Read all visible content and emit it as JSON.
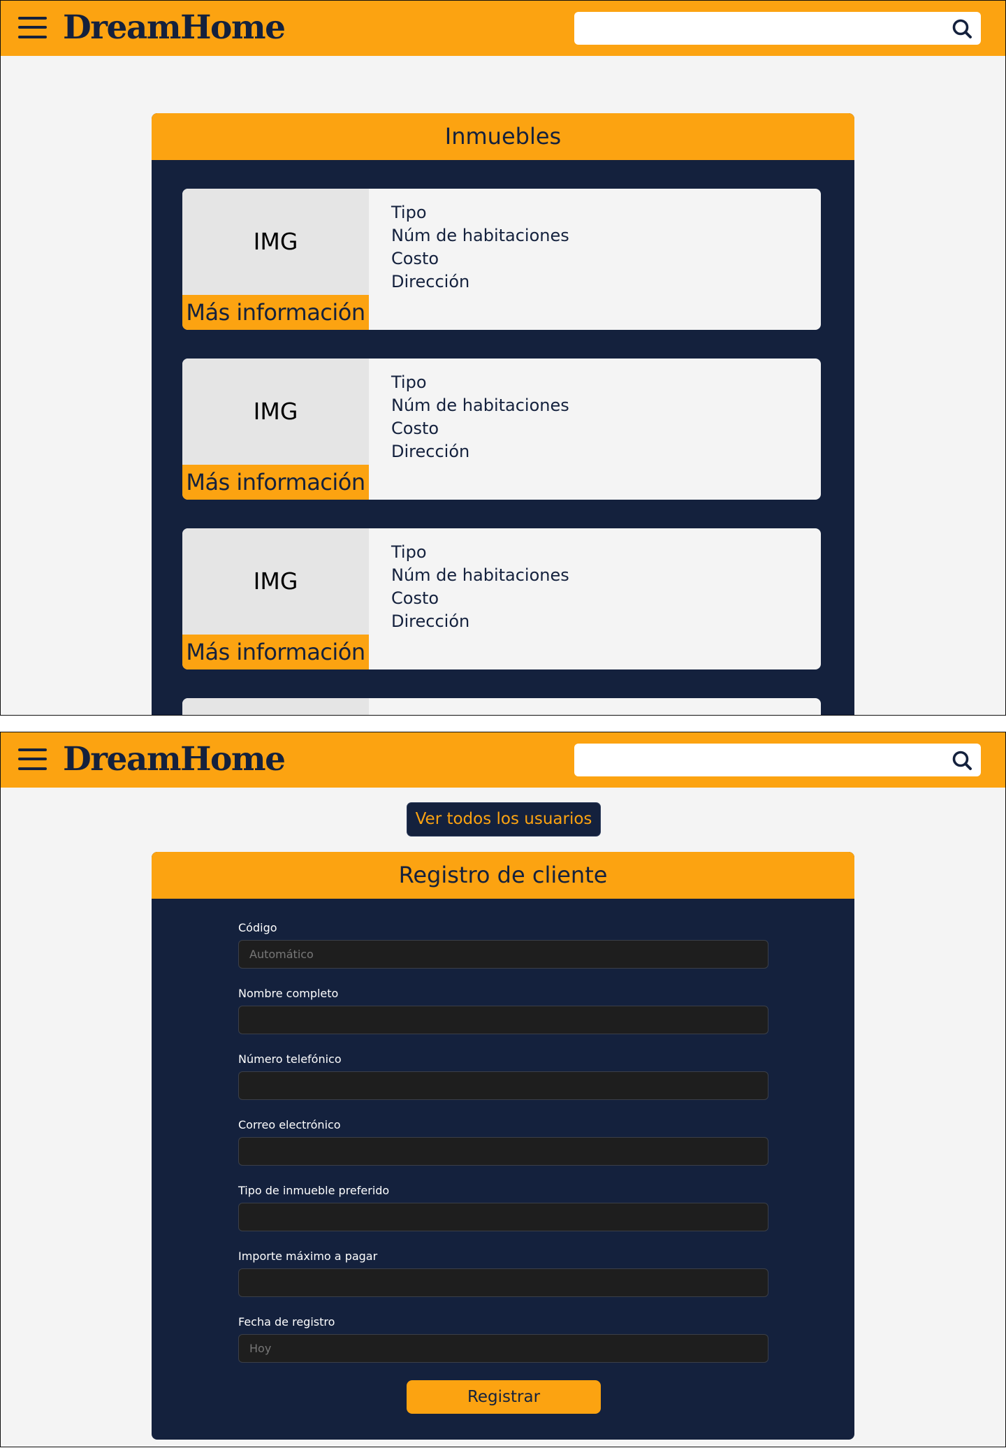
{
  "app": {
    "logo": "DreamHome",
    "search": {
      "placeholder": ""
    }
  },
  "colors": {
    "accent": "#fca311",
    "navy": "#14213d",
    "background": "#f4f4f4"
  },
  "icons": [
    "menu-icon",
    "search-icon"
  ],
  "listing_page": {
    "title": "Inmuebles",
    "cards": [
      {
        "image_label": "IMG",
        "more_label": "Más información",
        "fields": [
          "Tipo",
          "Núm de habitaciones",
          "Costo",
          "Dirección"
        ]
      },
      {
        "image_label": "IMG",
        "more_label": "Más información",
        "fields": [
          "Tipo",
          "Núm de habitaciones",
          "Costo",
          "Dirección"
        ]
      },
      {
        "image_label": "IMG",
        "more_label": "Más información",
        "fields": [
          "Tipo",
          "Núm de habitaciones",
          "Costo",
          "Dirección"
        ]
      },
      {
        "image_label": "",
        "more_label": "",
        "fields": [
          "",
          "",
          "",
          ""
        ]
      }
    ]
  },
  "register_page": {
    "view_users_button": "Ver todos los usuarios",
    "title": "Registro de cliente",
    "fields": [
      {
        "label": "Código",
        "value": "",
        "placeholder": "Automático"
      },
      {
        "label": "Nombre completo",
        "value": "",
        "placeholder": ""
      },
      {
        "label": "Número telefónico",
        "value": "",
        "placeholder": ""
      },
      {
        "label": "Correo electrónico",
        "value": "",
        "placeholder": ""
      },
      {
        "label": "Tipo de inmueble preferido",
        "value": "",
        "placeholder": ""
      },
      {
        "label": "Importe máximo a pagar",
        "value": "",
        "placeholder": ""
      },
      {
        "label": "Fecha de registro",
        "value": "",
        "placeholder": "Hoy"
      }
    ],
    "submit_button": "Registrar"
  }
}
